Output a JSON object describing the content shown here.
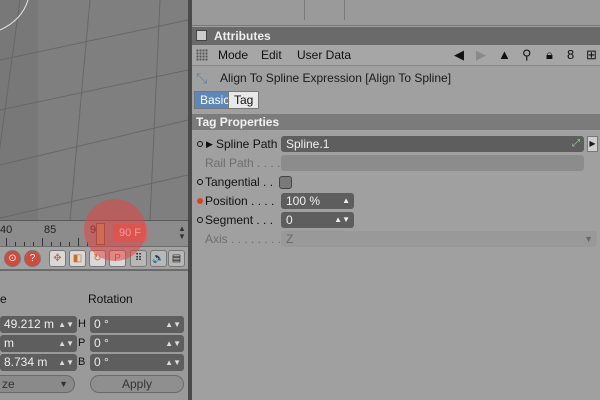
{
  "timeline": {
    "ticks": [
      "40",
      "85",
      "9"
    ],
    "current_frame": "90 F"
  },
  "coordinates": {
    "col_size": "e",
    "col_rotation": "Rotation",
    "rows": [
      {
        "value": "49.212 m",
        "axis": "H",
        "rotation": "0 °"
      },
      {
        "value": "m",
        "axis": "P",
        "rotation": "0 °"
      },
      {
        "value": "8.734 m",
        "axis": "B",
        "rotation": "0 °"
      }
    ],
    "mode": "ze",
    "apply": "Apply"
  },
  "attributes": {
    "title": "Attributes",
    "menu": [
      "Mode",
      "Edit",
      "User Data"
    ],
    "object": "Align To Spline Expression [Align To Spline]",
    "tabs": [
      "Basic",
      "Tag"
    ],
    "section": "Tag Properties",
    "props": {
      "spline_path": {
        "label": "Spline Path",
        "value": "Spline.1"
      },
      "rail_path": {
        "label": "Rail Path . . . . ."
      },
      "tangential": {
        "label": "Tangential . ."
      },
      "position": {
        "label": "Position . . . .",
        "value": "100 %"
      },
      "segment": {
        "label": "Segment . . .",
        "value": "0"
      },
      "axis": {
        "label": "Axis . . . . . . . .",
        "value": "Z"
      }
    }
  },
  "colors": {
    "accent_tab": "#5f86b8",
    "frame_field": "#cf6860",
    "highlight": "#e64646"
  }
}
